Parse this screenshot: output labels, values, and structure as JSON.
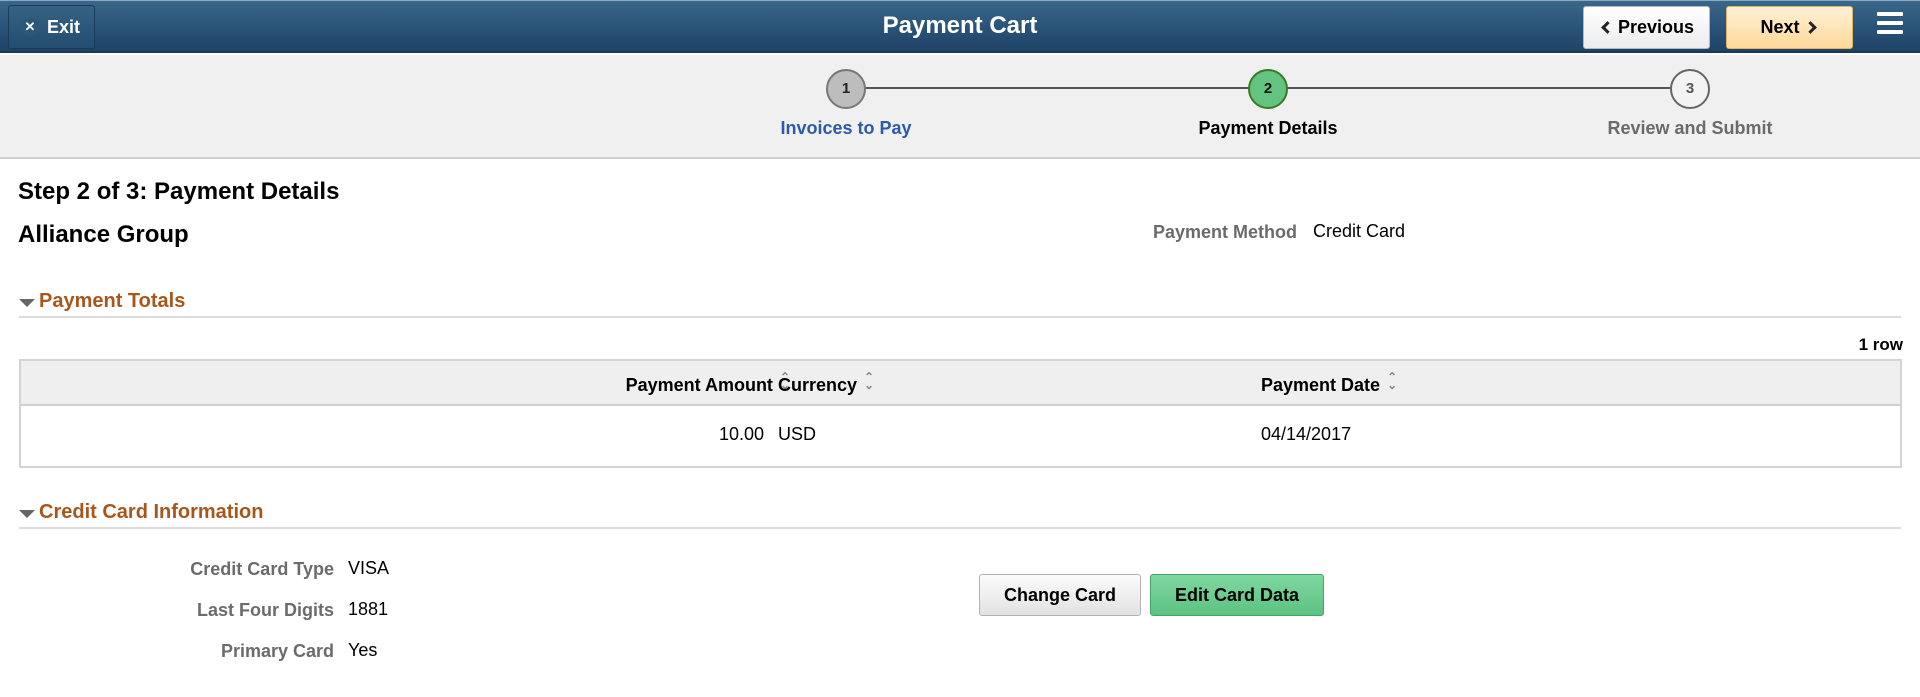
{
  "header": {
    "exit_label": "Exit",
    "exit_icon": "close-icon",
    "title": "Payment Cart",
    "previous_label": "Previous",
    "next_label": "Next",
    "menu_icon": "hamburger-menu-icon"
  },
  "train": {
    "stops": [
      {
        "number": "1",
        "label": "Invoices to Pay",
        "state": "completed"
      },
      {
        "number": "2",
        "label": "Payment Details",
        "state": "current"
      },
      {
        "number": "3",
        "label": "Review and Submit",
        "state": "upcoming"
      }
    ]
  },
  "page": {
    "step_heading": "Step 2 of 3: Payment Details",
    "organization": "Alliance Group",
    "payment_method_label": "Payment Method",
    "payment_method_value": "Credit Card"
  },
  "payment_totals": {
    "title": "Payment Totals",
    "row_count": "1 row",
    "columns": [
      "Payment Amount",
      "Currency",
      "Payment Date"
    ],
    "rows": [
      {
        "amount": "10.00",
        "currency": "USD",
        "date": "04/14/2017"
      }
    ]
  },
  "credit_card": {
    "title": "Credit Card Information",
    "fields": [
      {
        "label": "Credit Card Type",
        "value": "VISA"
      },
      {
        "label": "Last Four Digits",
        "value": "1881"
      },
      {
        "label": "Primary Card",
        "value": "Yes"
      }
    ],
    "change_card_label": "Change Card",
    "edit_card_label": "Edit Card Data"
  },
  "colors": {
    "header_bg": "#2a5479",
    "next_button": "#ffd89a",
    "current_step": "#62c47e",
    "group_title": "#a8571c",
    "link": "#2b5ba8",
    "edit_button": "#5cc283"
  }
}
